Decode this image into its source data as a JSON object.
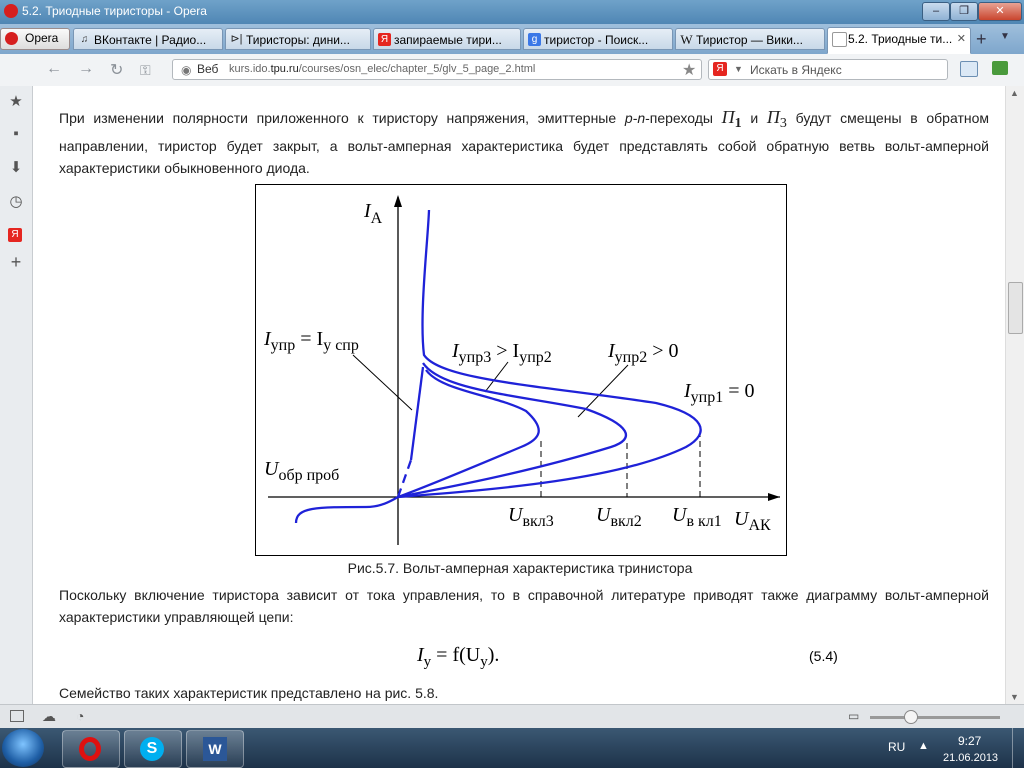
{
  "window": {
    "title": "5.2. Триодные тиристоры - Opera",
    "minimize": "–",
    "maximize": "❐",
    "close": "✕"
  },
  "menu_button": "Opera",
  "tabs": [
    {
      "label": "ВКонтакте | Радио...",
      "icon": "music-note-icon",
      "active": false
    },
    {
      "label": "Тиристоры: дини...",
      "icon": "diode-icon",
      "active": false
    },
    {
      "label": "запираемые тири...",
      "icon": "yandex-icon",
      "active": false
    },
    {
      "label": "тиристор - Поиск...",
      "icon": "google-icon",
      "active": false
    },
    {
      "label": "Тиристор — Вики...",
      "icon": "wikipedia-icon",
      "active": false
    },
    {
      "label": "5.2. Триодные ти...",
      "icon": "page-icon",
      "active": true
    }
  ],
  "nav": {
    "web_label": "Веб",
    "url_host": "kurs.ido.",
    "url_domain": "tpu.ru",
    "url_path": "/courses/osn_elec/chapter_5/glv_5_page_2.html",
    "search_placeholder": "Искать в Яндекс",
    "search_logo": "Я"
  },
  "content": {
    "para1_a": "При изменении полярности приложенного к тиристору напряжения, эмиттерные ",
    "para1_pn": "p-n",
    "para1_b": "-переходы ",
    "para1_p1": "П",
    "para1_p1_sub": "1",
    "para1_and": " и ",
    "para1_p3": "П",
    "para1_p3_sub": "3",
    "para1_c": " будут смещены в обратном направлении, тиристор будет закрыт, а вольт-амперная характеристика будет представлять собой обратную ветвь вольт-амперной характеристики обыкновенного диода.",
    "figure_caption": "Рис.5.7. Вольт-амперная характеристика тринистора",
    "para2": "Поскольку включение тиристора зависит от тока управления, то в справочной литературе приводят также диаграмму вольт-амперной характеристики управляющей цепи:",
    "formula_lhs": "I",
    "formula_lhs_sub": "у",
    "formula_rhs_a": " = f(U",
    "formula_rhs_sub": "у",
    "formula_rhs_b": ").",
    "eq_number": "(5.4)",
    "para3": "Семейство таких характеристик представлено на рис. 5.8."
  },
  "chart_data": {
    "type": "line",
    "title": "",
    "xlabel": "U_АК",
    "ylabel": "I_А",
    "labels": {
      "y_axis_I": "I",
      "y_axis_sub": "А",
      "x_axis_U": "U",
      "x_axis_sub": "АК",
      "holding_I": "I",
      "holding_sub1": "упр",
      "holding_eq": " = I",
      "holding_sub2": "у спр",
      "series3_I": "I",
      "series3_sub": "упр3",
      "series3_gt": " > I",
      "series3_sub2": "упр2",
      "series2_I": "I",
      "series2_sub": "упр2",
      "series2_gt": " > 0",
      "series1_I": "I",
      "series1_sub": "упр1",
      "series1_eq": " = 0",
      "breakdown_U": "U",
      "breakdown_sub": "обр проб",
      "uon3_U": "U",
      "uon3_sub": "вкл3",
      "uon2_U": "U",
      "uon2_sub": "вкл2",
      "uon1_U": "U",
      "uon1_sub": "в кл1"
    },
    "series": [
      {
        "name": "Iупр1 = 0",
        "role": "control current 1 (largest switch-on voltage)"
      },
      {
        "name": "Iупр2 > 0",
        "role": "control current 2"
      },
      {
        "name": "Iупр3 > Iупр2",
        "role": "control current 3 (smallest switch-on voltage)"
      },
      {
        "name": "Iупр = Iу спр",
        "role": "straightened characteristic (dashed)"
      }
    ],
    "switch_on_voltages_order": [
      "Uвкл3",
      "Uвкл2",
      "Uв кл1"
    ],
    "grid": false
  },
  "status": {
    "zoom_icon": "zoom-slider"
  },
  "taskbar": {
    "lang": "RU",
    "time": "9:27",
    "date": "21.06.2013"
  }
}
